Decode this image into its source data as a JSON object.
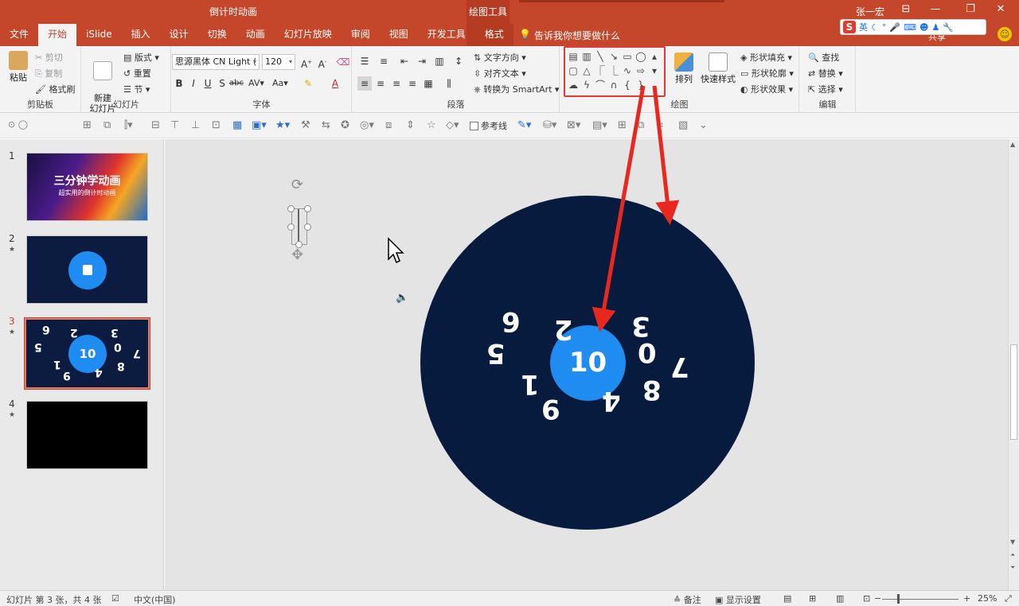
{
  "window": {
    "title": "倒计时动画",
    "context_group": "绘图工具",
    "user": "张一宏",
    "tell_me": "告诉我你想要做什么",
    "share": "共享"
  },
  "ime": {
    "logo": "S",
    "mode": "英"
  },
  "tabs": [
    "文件",
    "开始",
    "iSlide",
    "插入",
    "设计",
    "切换",
    "动画",
    "幻灯片放映",
    "审阅",
    "视图",
    "开发工具",
    "格式"
  ],
  "ribbon": {
    "clipboard": {
      "name": "剪贴板",
      "paste": "粘贴",
      "cut": "剪切",
      "copy": "复制",
      "painter": "格式刷"
    },
    "slides": {
      "name": "幻灯片",
      "new_slide": "新建\n幻灯片",
      "layout": "版式",
      "reset": "重置",
      "section": "节"
    },
    "font": {
      "name": "字体",
      "family": "思源黑体 CN Light (",
      "size": "120"
    },
    "paragraph": {
      "name": "段落",
      "text_dir": "文字方向",
      "align_text": "对齐文本",
      "smartart": "转换为 SmartArt"
    },
    "drawing": {
      "name": "绘图",
      "arrange": "排列",
      "quick_styles": "快速样式",
      "fill": "形状填充",
      "outline": "形状轮廓",
      "effects": "形状效果"
    },
    "editing": {
      "name": "编辑",
      "find": "查找",
      "replace": "替换",
      "select": "选择"
    }
  },
  "qat": {
    "guides": "参考线"
  },
  "thumbnails": {
    "slide1_title": "三分钟学动画",
    "slide1_subtitle": "超实用的倒计时动画",
    "slide3_center": "10",
    "numbers": [
      "1",
      "2",
      "3",
      "4",
      "5"
    ]
  },
  "canvas": {
    "center": "10",
    "digits": [
      {
        "label": "6"
      },
      {
        "label": "5"
      },
      {
        "label": "2"
      },
      {
        "label": "3"
      },
      {
        "label": "0"
      },
      {
        "label": "7"
      },
      {
        "label": "1"
      },
      {
        "label": "4"
      },
      {
        "label": "8"
      },
      {
        "label": "9"
      }
    ]
  },
  "status": {
    "slide_info": "幻灯片 第 3 张，共 4 张",
    "language": "中文(中国)",
    "notes": "备注",
    "display": "显示设置",
    "zoom": "25%"
  },
  "colors": {
    "accent": "#c5472b",
    "dial": "#071b3e",
    "circle": "#1e8cf0",
    "annotation": "#e8281f"
  }
}
